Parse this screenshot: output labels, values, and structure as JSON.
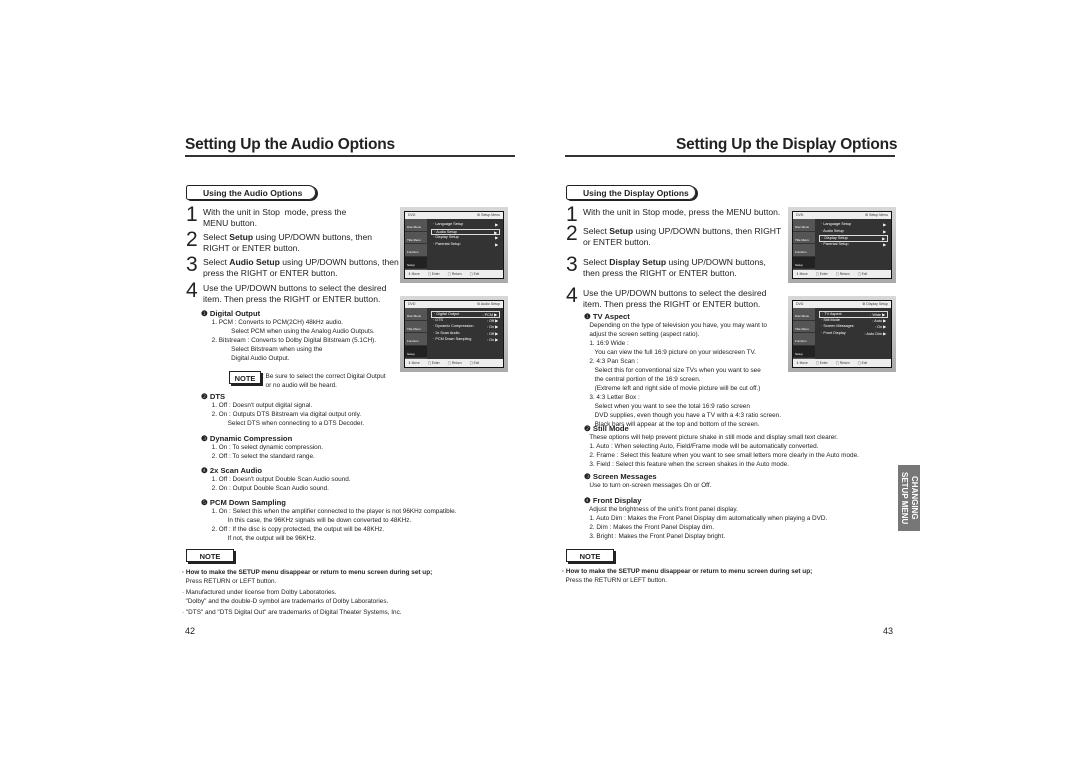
{
  "left": {
    "title": "Setting Up the Audio Options",
    "section": "Using the Audio Options",
    "steps": [
      {
        "n": "1",
        "text": "With the unit in Stop  mode, press the\nMENU button."
      },
      {
        "n": "2",
        "text": "Select Setup using UP/DOWN buttons, then\nRIGHT or ENTER button."
      },
      {
        "n": "3",
        "text": "Select Audio Setup using UP/DOWN buttons, then\npress the RIGHT or ENTER button."
      },
      {
        "n": "4",
        "text": "Use the UP/DOWN buttons to select the desired\nitem. Then press the RIGHT or ENTER button."
      }
    ],
    "items": [
      {
        "h": "❶ Digital Output",
        "lines": "      1. PCM : Converts to PCM(2CH) 48kHz audio.\n                 Select PCM when using the Analog Audio Outputs.\n      2. Bitstream : Converts to Dolby Digital Bitstream (5.1CH).\n                 Select Bitstream when using the\n                 Digital Audio Output."
      },
      {
        "h": "❷ DTS",
        "lines": "      1. Off : Doesn't output digital signal.\n      2. On : Outputs DTS Bitstream via digital output only.\n               Select DTS when connecting to a DTS Decoder."
      },
      {
        "h": "❸ Dynamic Compression",
        "lines": "      1. On : To select dynamic compression.\n      2. Off : To select the standard range."
      },
      {
        "h": "❹ 2x Scan Audio",
        "lines": "      1. Off : Doesn't output Double Scan Audio sound.\n      2. On : Output Double Scan Audio sound."
      },
      {
        "h": "❺ PCM Down Sampling",
        "lines": "      1. On : Select this when the amplifier connected to the player is not 96KHz compatible.\n               In this case, the 96KHz signals will be down converted to 48KHz.\n      2. Off : If the disc is copy protected, the output will be 48KHz.\n               If not, the output will be 96KHz."
      }
    ],
    "inline_note": {
      "label": "NOTE",
      "text": ": Be sure to select the correct Digital Output\n  or no audio will be heard."
    },
    "note_label": "NOTE",
    "notes": [
      {
        "bold": "· How to make the SETUP menu disappear or return to menu screen during set up;",
        "text": "  Press RETURN or LEFT button."
      },
      {
        "bold": "",
        "text": "· Manufactured under license from Dolby Laboratories.\n  \"Dolby\" and the double-D symbol are trademarks of Dolby Laboratories."
      },
      {
        "bold": "",
        "text": "· \"DTS\" and \"DTS Digital Out\" are trademarks of Digital Theater Systems, Inc."
      }
    ],
    "page": "42",
    "menus": [
      {
        "brand": "DVD",
        "title": "⚙ Setup Menu",
        "items": [
          {
            "l": "· Language Setup",
            "v": "▶"
          },
          {
            "l": "· Audio Setup",
            "v": "▶",
            "sel": true
          },
          {
            "l": "· Display Setup",
            "v": "▶"
          },
          {
            "l": "· Parental Setup",
            "v": "▶"
          }
        ]
      },
      {
        "brand": "DVD",
        "title": "⚙ Audio Setup",
        "items": [
          {
            "l": "· Digital Output",
            "v": ": PCM ▶",
            "sel": true
          },
          {
            "l": "· DTS",
            "v": ": Off ▶"
          },
          {
            "l": "· Dynamic Compression",
            "v": ": On ▶"
          },
          {
            "l": "· 2x Scan Audio",
            "v": ": Off ▶"
          },
          {
            "l": "· PCM Down Sampling",
            "v": ": On ▶"
          }
        ]
      }
    ]
  },
  "right": {
    "title": "Setting Up the Display Options",
    "section": "Using the Display Options",
    "steps": [
      {
        "n": "1",
        "text": "With the unit in Stop mode, press the MENU button."
      },
      {
        "n": "2",
        "text": "Select Setup using UP/DOWN buttons, then RIGHT\nor ENTER button."
      },
      {
        "n": "3",
        "text": "Select Display Setup using UP/DOWN buttons,\nthen press the RIGHT or ENTER button."
      },
      {
        "n": "4",
        "text": "Use the UP/DOWN buttons to select the desired\nitem. Then press the RIGHT or ENTER button."
      }
    ],
    "items": [
      {
        "h": "❶ TV Aspect",
        "lines": "   Depending on the type of television you have, you may want to\n   adjust the screen setting (aspect ratio).\n   1. 16:9 Wide :\n      You can view the full 16:9 picture on your widescreen TV.\n   2. 4:3 Pan Scan :\n      Select this for conventional size TVs when you want to see\n      the central portion of the 16:9 screen.\n      (Extreme left and right side of movie picture will be cut off.)\n   3. 4:3 Letter Box :\n      Select when you want to see the total 16:9 ratio screen\n      DVD supplies, even though you have a TV with a 4:3 ratio screen.\n      Black bars will appear at the top and bottom of the screen."
      },
      {
        "h": "❷ Still Mode",
        "lines": "   These options will help prevent picture shake in still mode and display small text clearer.\n   1. Auto : When selecting Auto, Field/Frame mode will be automatically converted.\n   2. Frame : Select this feature when you want to see small letters more clearly in the Auto mode.\n   3. Field : Select this feature when the screen shakes in the Auto mode."
      },
      {
        "h": "❸ Screen Messages",
        "lines": "   Use to turn on-screen messages On or Off."
      },
      {
        "h": "❹ Front Display",
        "lines": "   Adjust the brightness of the unit's front panel display.\n   1. Auto Dim : Makes the Front Panel Display dim automatically when playing a DVD.\n   2. Dim : Makes the Front Panel Display dim.\n   3. Bright : Makes the Front Panel Display bright."
      }
    ],
    "note_label": "NOTE",
    "notes": [
      {
        "bold": "· How to make the SETUP menu disappear or return to menu screen during set up;",
        "text": "  Press the RETURN or LEFT button."
      }
    ],
    "page": "43",
    "side_tab": "CHANGING SETUP MENU",
    "menus": [
      {
        "brand": "DVD",
        "title": "⚙ Setup Menu",
        "items": [
          {
            "l": "· Language Setup",
            "v": "▶"
          },
          {
            "l": "· Audio Setup",
            "v": "▶"
          },
          {
            "l": "· Display Setup",
            "v": "▶",
            "sel": true
          },
          {
            "l": "· Parental Setup",
            "v": "▶"
          }
        ]
      },
      {
        "brand": "DVD",
        "title": "⚙ Display Setup",
        "items": [
          {
            "l": "· TV Aspect",
            "v": ": Wide ▶",
            "sel": true
          },
          {
            "l": "· Still Mode",
            "v": ": Auto ▶"
          },
          {
            "l": "· Screen Messages",
            "v": ": On ▶"
          },
          {
            "l": "· Front Display",
            "v": ": Auto Dim ▶"
          }
        ]
      }
    ]
  },
  "menu_common": {
    "side": [
      "Disc Menu",
      "Title Menu",
      "Function",
      "Setup"
    ],
    "bottom": [
      "⇕ Move",
      "▢ Enter",
      "▢ Return",
      "▢ Exit"
    ]
  }
}
